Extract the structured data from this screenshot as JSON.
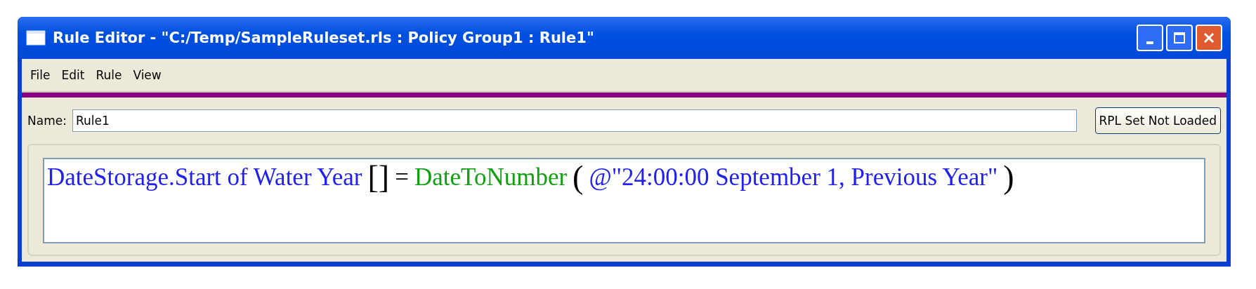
{
  "window": {
    "title": "Rule Editor - \"C:/Temp/SampleRuleset.rls : Policy Group1 : Rule1\""
  },
  "menu": [
    "File",
    "Edit",
    "Rule",
    "View"
  ],
  "name_field": {
    "label": "Name:",
    "value": "Rule1"
  },
  "status_button": {
    "label": "RPL Set Not Loaded"
  },
  "expression": [
    {
      "kind": "slot",
      "text": "DateStorage.Start of Water Year"
    },
    {
      "kind": "bracket",
      "text": "[]"
    },
    {
      "kind": "operator",
      "text": "="
    },
    {
      "kind": "function",
      "text": "DateToNumber"
    },
    {
      "kind": "bracket",
      "text": "("
    },
    {
      "kind": "slot",
      "text": "@\"24:00:00 September 1, Previous Year\""
    },
    {
      "kind": "bracket",
      "text": ")"
    }
  ]
}
